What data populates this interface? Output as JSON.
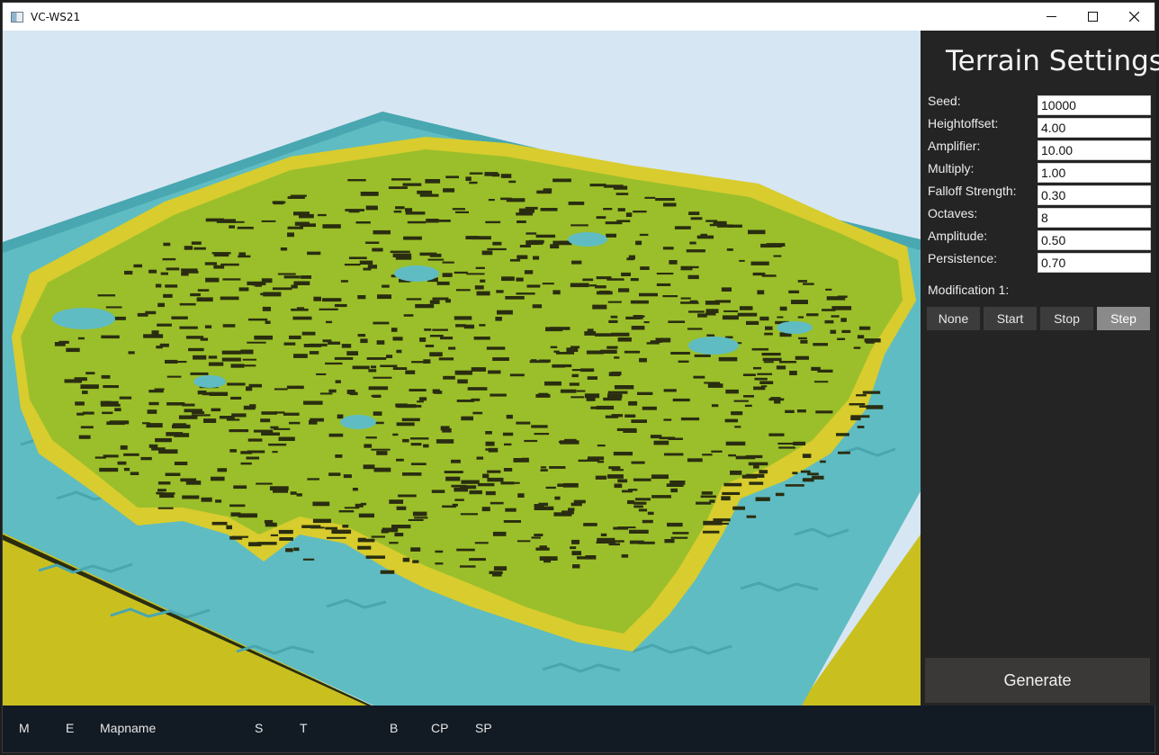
{
  "window": {
    "title": "VC-WS21"
  },
  "panel": {
    "title": "Terrain Settings",
    "fields": [
      {
        "label": "Seed:",
        "value": "10000"
      },
      {
        "label": "Heightoffset:",
        "value": "4.00"
      },
      {
        "label": "Amplifier:",
        "value": "10.00"
      },
      {
        "label": "Multiply:",
        "value": "1.00"
      },
      {
        "label": "Falloff Strength:",
        "value": "0.30"
      },
      {
        "label": "Octaves:",
        "value": "8"
      },
      {
        "label": "Amplitude:",
        "value": "0.50"
      },
      {
        "label": "Persistence:",
        "value": "0.70"
      }
    ],
    "modification_label": "Modification 1:",
    "modification_buttons": [
      "None",
      "Start",
      "Stop",
      "Step"
    ],
    "active_modification": "Step",
    "generate_label": "Generate"
  },
  "toolbar": {
    "items": [
      "M",
      "E",
      "Mapname",
      "S",
      "T",
      "B",
      "CP",
      "SP"
    ]
  },
  "colors": {
    "sky": "#d6e6f2",
    "water": "#5fbcc2",
    "water_edge": "#42a5ad",
    "sand": "#d8cc2e",
    "grass": "#9bbf2a",
    "shadow": "#2a2d10",
    "panel_bg": "#242424",
    "toolbar_bg": "#121a24"
  }
}
